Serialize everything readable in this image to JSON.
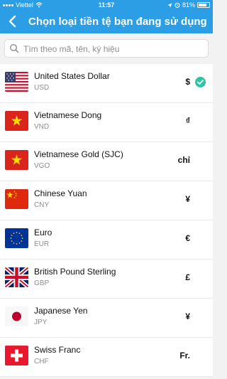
{
  "status_bar": {
    "carrier": "Viettel",
    "time": "11:57",
    "battery": "81%",
    "battery_level": 0.81
  },
  "header": {
    "title": "Chọn loại tiền tệ bạn đang sử dụng"
  },
  "search": {
    "placeholder": "Tìm theo mã, tên, ký hiệu",
    "value": ""
  },
  "currencies": [
    {
      "name": "United States Dollar",
      "code": "USD",
      "symbol": "$",
      "selected": true,
      "flag": "us-flag"
    },
    {
      "name": "Vietnamese Dong",
      "code": "VND",
      "symbol": "₫",
      "selected": false,
      "flag": "vn-flag"
    },
    {
      "name": "Vietnamese Gold (SJC)",
      "code": "VGO",
      "symbol": "chỉ",
      "selected": false,
      "flag": "vn-flag"
    },
    {
      "name": "Chinese Yuan",
      "code": "CNY",
      "symbol": "¥",
      "selected": false,
      "flag": "cn-flag"
    },
    {
      "name": "Euro",
      "code": "EUR",
      "symbol": "€",
      "selected": false,
      "flag": "eu-flag"
    },
    {
      "name": "British Pound Sterling",
      "code": "GBP",
      "symbol": "£",
      "selected": false,
      "flag": "gb-flag"
    },
    {
      "name": "Japanese Yen",
      "code": "JPY",
      "symbol": "¥",
      "selected": false,
      "flag": "jp-flag"
    },
    {
      "name": "Swiss Franc",
      "code": "CHF",
      "symbol": "Fr.",
      "selected": false,
      "flag": "ch-flag"
    }
  ],
  "colors": {
    "accent": "#2b9ee6",
    "check": "#2ec4a6"
  }
}
